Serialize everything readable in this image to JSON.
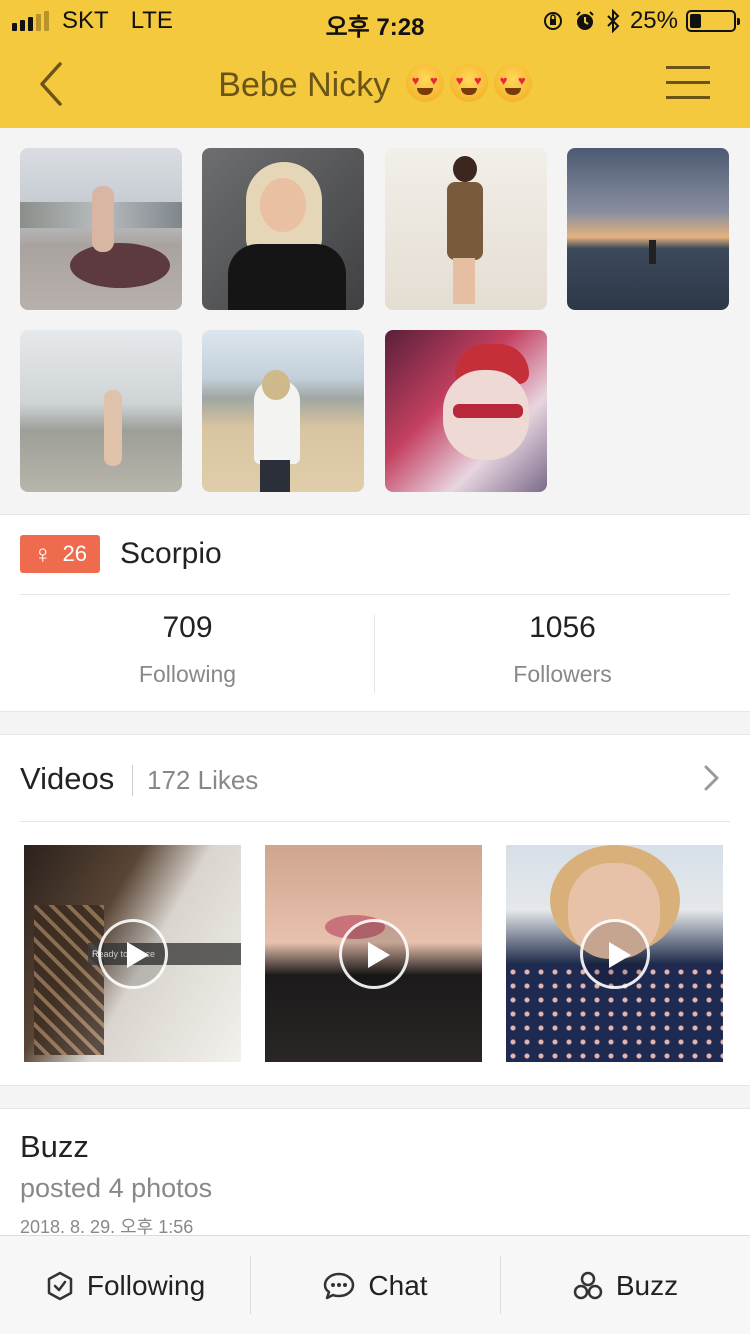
{
  "status_bar": {
    "carrier": "SKT",
    "network": "LTE",
    "time": "오후 7:28",
    "battery_text": "25%",
    "battery_level": 0.25
  },
  "navbar": {
    "title": "Bebe Nicky",
    "emojis": [
      "heart-eyes-emoji",
      "heart-eyes-emoji",
      "heart-eyes-emoji"
    ],
    "back_icon": "chevron-left-icon",
    "menu_icon": "hamburger-menu-icon",
    "background": "#f5c93e"
  },
  "profile": {
    "gender_symbol": "♀",
    "age": "26",
    "zodiac": "Scorpio",
    "badge_color": "#ef6b4e",
    "following_count": "709",
    "following_label": "Following",
    "followers_count": "1056",
    "followers_label": "Followers"
  },
  "videos": {
    "title": "Videos",
    "likes": "172 Likes",
    "items": [
      {
        "overlay_text": "Ready to dance"
      },
      {
        "overlay_text": ""
      },
      {
        "overlay_text": ""
      }
    ]
  },
  "buzz": {
    "title": "Buzz",
    "subtitle": "posted 4 photos",
    "date": "2018. 8. 29. 오후 1:56"
  },
  "tabbar": {
    "tabs": [
      {
        "label": "Following",
        "icon": "hexagon-check-icon"
      },
      {
        "label": "Chat",
        "icon": "chat-bubble-icon"
      },
      {
        "label": "Buzz",
        "icon": "buzz-circles-icon"
      }
    ]
  }
}
